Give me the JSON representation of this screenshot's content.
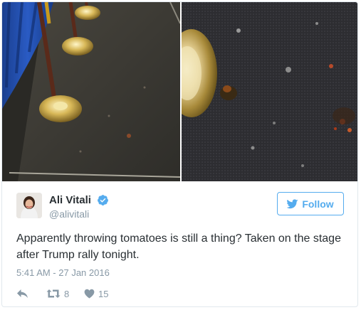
{
  "tweet": {
    "user": {
      "name": "Ali Vitali",
      "handle": "@alivitali",
      "verified": true
    },
    "follow_label": "Follow",
    "text": "Apparently throwing tomatoes is still a thing? Taken on the stage after Trump rally tonight.",
    "timestamp": "5:41 AM - 27 Jan 2016",
    "retweet_count": "8",
    "like_count": "15"
  },
  "colors": {
    "brand_blue": "#55acee",
    "muted_text": "#8899a6",
    "body_text": "#292f33",
    "border": "#e1e8ed"
  },
  "icons": {
    "verified": "verified-badge-icon",
    "twitter_bird": "twitter-bird-icon",
    "reply": "reply-icon",
    "retweet": "retweet-icon",
    "like": "heart-icon"
  }
}
